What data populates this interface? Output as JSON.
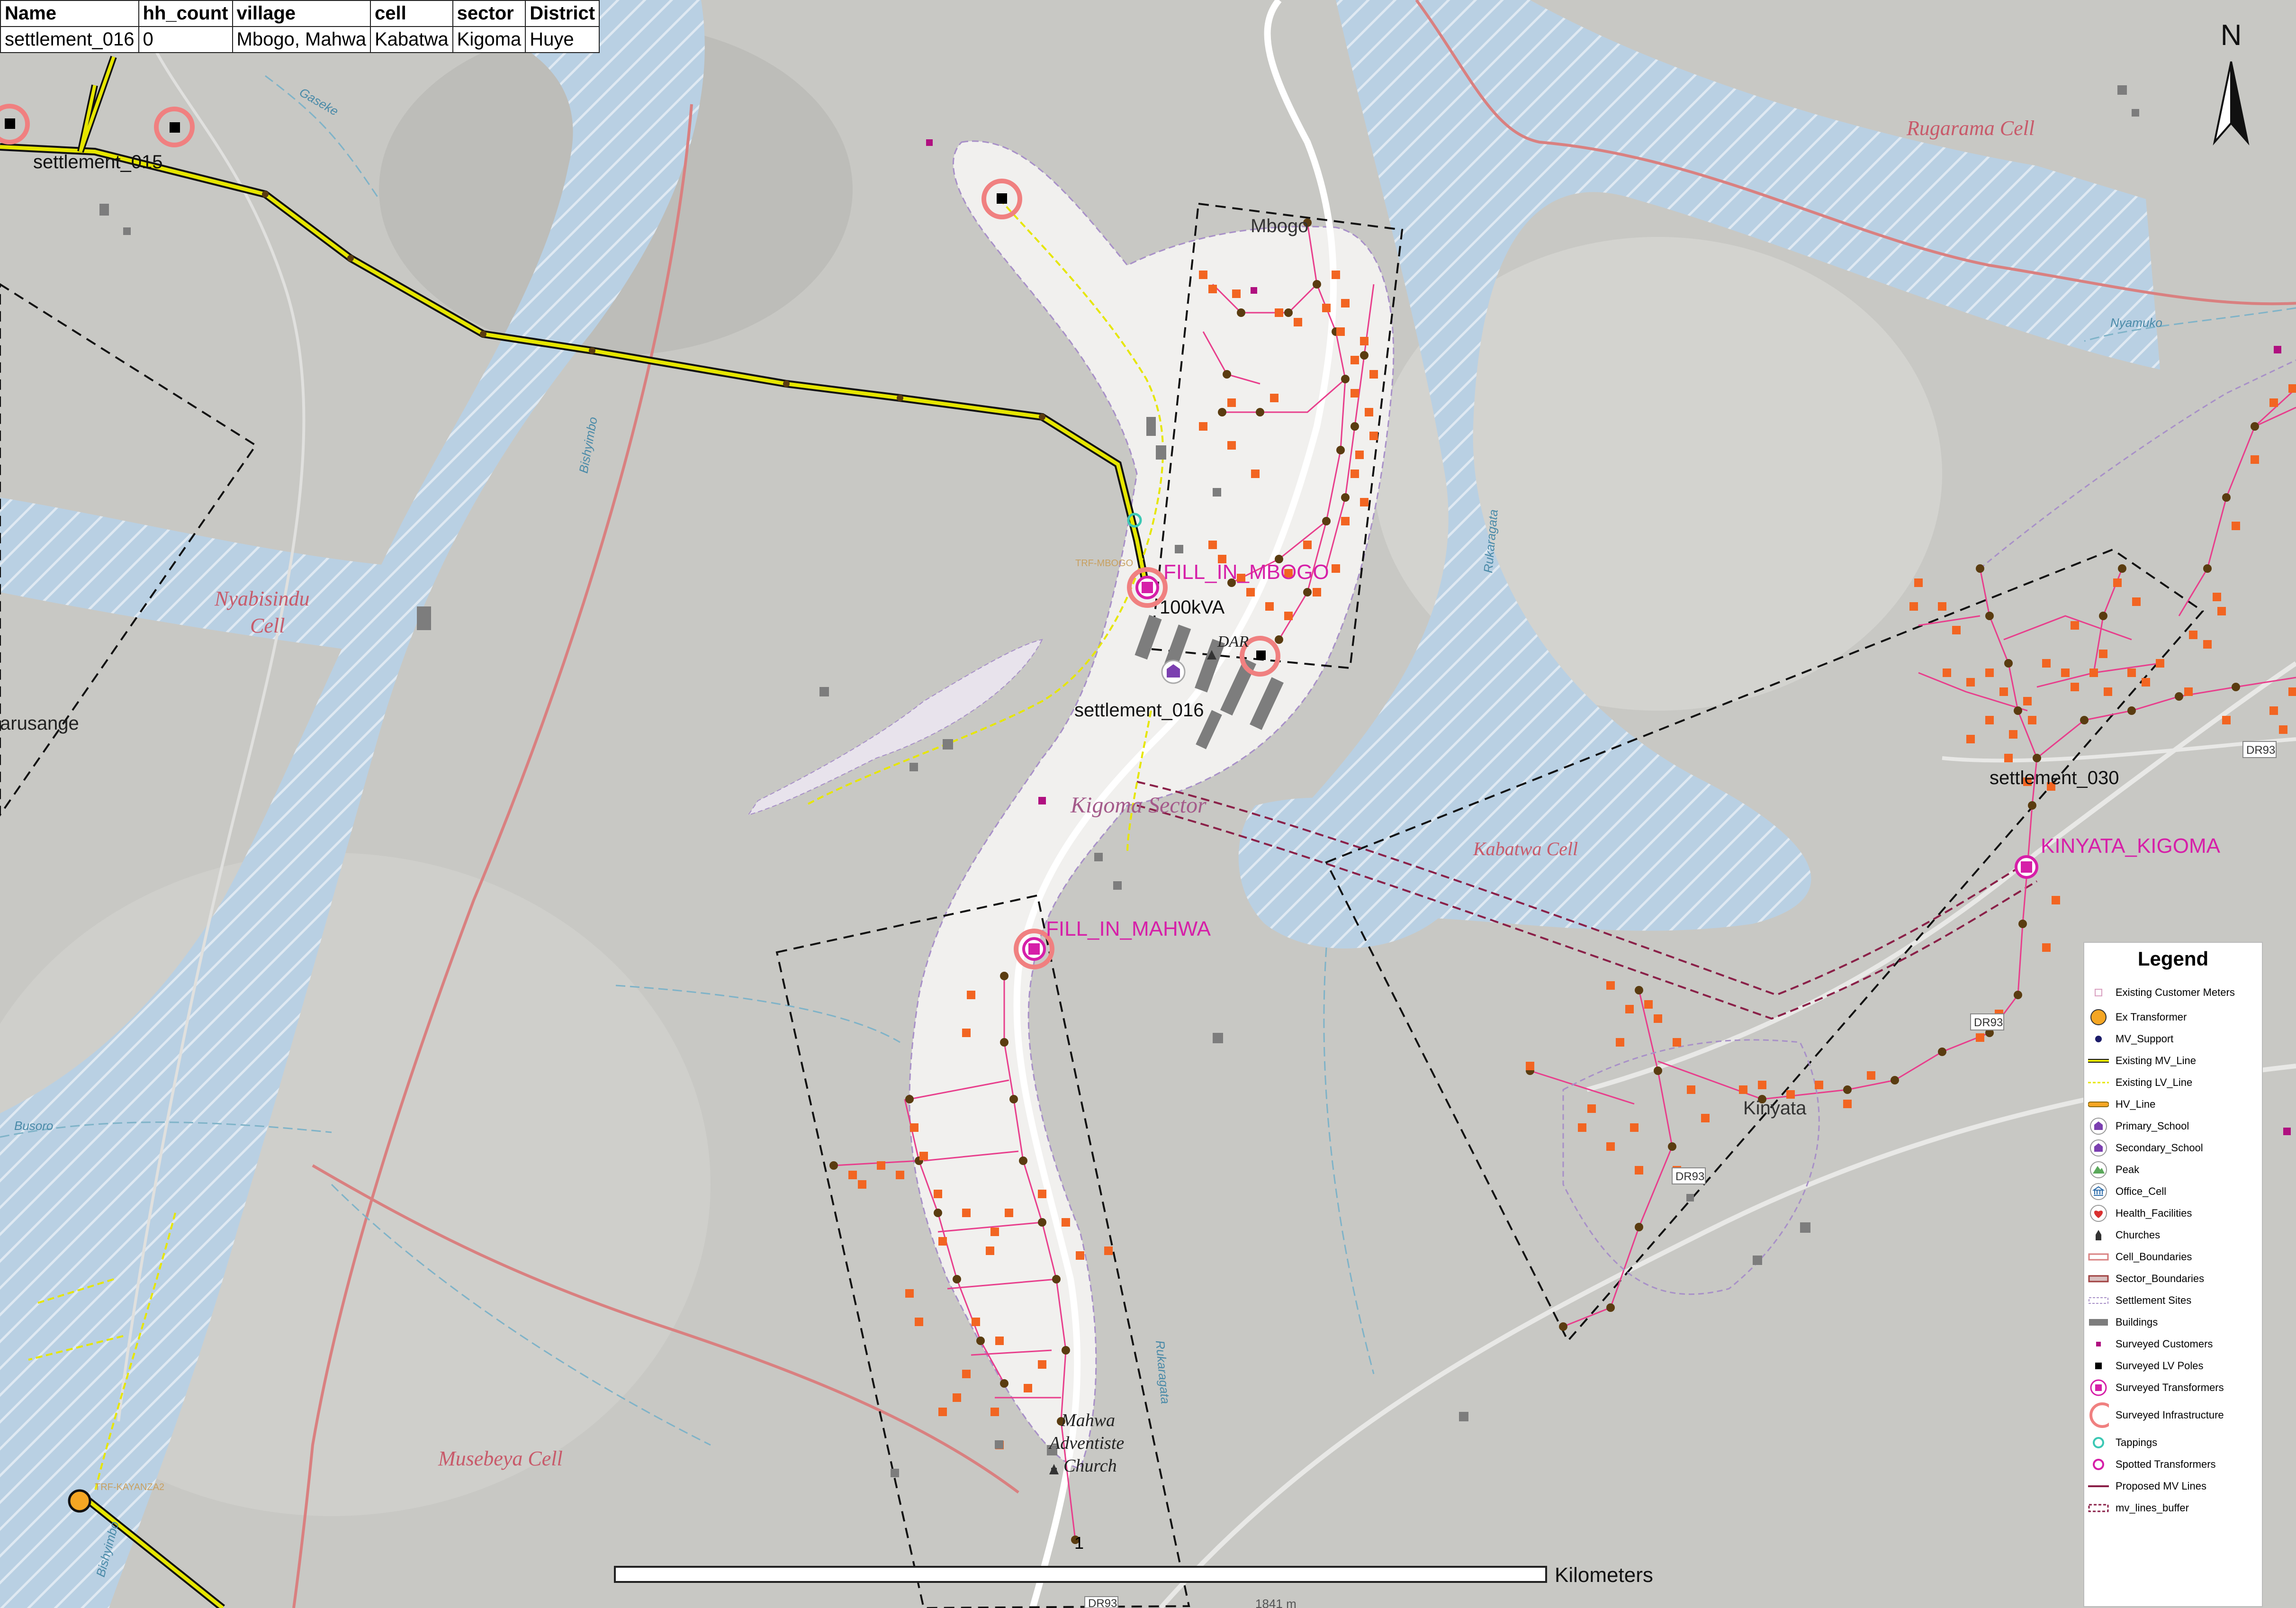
{
  "attribute_table": {
    "headers": [
      "Name",
      "hh_count",
      "village",
      "cell",
      "sector",
      "District"
    ],
    "row": [
      "settlement_016",
      "0",
      "Mbogo, Mahwa",
      "Kabatwa",
      "Kigoma",
      "Huye"
    ]
  },
  "north_label": "N",
  "map_labels": {
    "rugarama_cell": "Rugarama Cell",
    "nyabisindu_cell": "Nyabisindu\nCell",
    "musebeya_cell": "Musebeya Cell",
    "kabatwa_cell": "Kabatwa Cell",
    "kigoma_sector": "Kigoma Sector",
    "mbogo": "Mbogo",
    "kinyata": "Kinyata",
    "arusange": "arusange",
    "mahwa_church": "Mahwa\nAdventiste\nChurch",
    "dar": "DAR",
    "river_gaseke": "Gaseke",
    "river_nyamuko": "Nyamuko",
    "river_bishyimbo": "Bishyimbo",
    "river_rukaragata": "Rukaragata",
    "river_rukaragata2": "Rukaragata",
    "river_busoro": "Busoro",
    "river_bishyimbo2": "Bishyimbo",
    "road_dr93_a": "DR93",
    "road_dr93_b": "DR93",
    "road_dr93_c": "DR93",
    "road_dr93_d": "DR93",
    "elev": "1841 m"
  },
  "settlements": {
    "s015": "settlement_015",
    "s016": "settlement_016",
    "s030": "settlement_030"
  },
  "transformers": {
    "fill_in_mbogo": "FILL_IN_MBOGO",
    "fill_in_mahwa": "FILL_IN_MAHWA",
    "kinyata_kigoma": "KINYATA_KIGOMA",
    "kva": "100kVA",
    "trf_label": "TRF-MBOGO",
    "trf_label2": "TRF-KAYANZA2"
  },
  "scale": {
    "label": "Kilometers",
    "tick": "1"
  },
  "legend": {
    "title": "Legend",
    "items": [
      {
        "label": "Existing Customer Meters",
        "icon": "customer-meter"
      },
      {
        "label": "Ex Transformer",
        "icon": "ex-transformer"
      },
      {
        "label": "MV_Support",
        "icon": "mv-support"
      },
      {
        "label": "Existing MV_Line",
        "icon": "mv-line"
      },
      {
        "label": "Existing LV_Line",
        "icon": "lv-line"
      },
      {
        "label": "HV_Line",
        "icon": "hv-line"
      },
      {
        "label": "Primary_School",
        "icon": "school"
      },
      {
        "label": "Secondary_School",
        "icon": "school"
      },
      {
        "label": "Peak",
        "icon": "peak"
      },
      {
        "label": "Office_Cell",
        "icon": "office"
      },
      {
        "label": "Health_Facilities",
        "icon": "health"
      },
      {
        "label": "Churches",
        "icon": "church"
      },
      {
        "label": "Cell_Boundaries",
        "icon": "cell-boundary"
      },
      {
        "label": "Sector_Boundaries",
        "icon": "sector-boundary"
      },
      {
        "label": "Settlement Sites",
        "icon": "settlement-site"
      },
      {
        "label": "Buildings",
        "icon": "building"
      },
      {
        "label": "Surveyed Customers",
        "icon": "surveyed-customer"
      },
      {
        "label": "Surveyed LV Poles",
        "icon": "lv-pole"
      },
      {
        "label": "Surveyed Transformers",
        "icon": "surveyed-transformer"
      },
      {
        "label": "Surveyed Infrastructure",
        "icon": "surveyed-infra"
      },
      {
        "label": "Tappings",
        "icon": "tapping"
      },
      {
        "label": "Spotted Transformers",
        "icon": "spotted-transformer"
      },
      {
        "label": "Proposed MV Lines",
        "icon": "proposed-mv"
      },
      {
        "label": "mv_lines_buffer",
        "icon": "mv-buffer"
      }
    ]
  },
  "colors": {
    "background": "#c9c9c6",
    "water": "#b6cde0",
    "settlement_fill": "#f1f0ee",
    "orange_customer": "#f26522",
    "pink_lv": "#e83e8c",
    "cell_boundary": "#d98080",
    "mv_line": "#e6e600",
    "magenta_label": "#d61fa8"
  }
}
